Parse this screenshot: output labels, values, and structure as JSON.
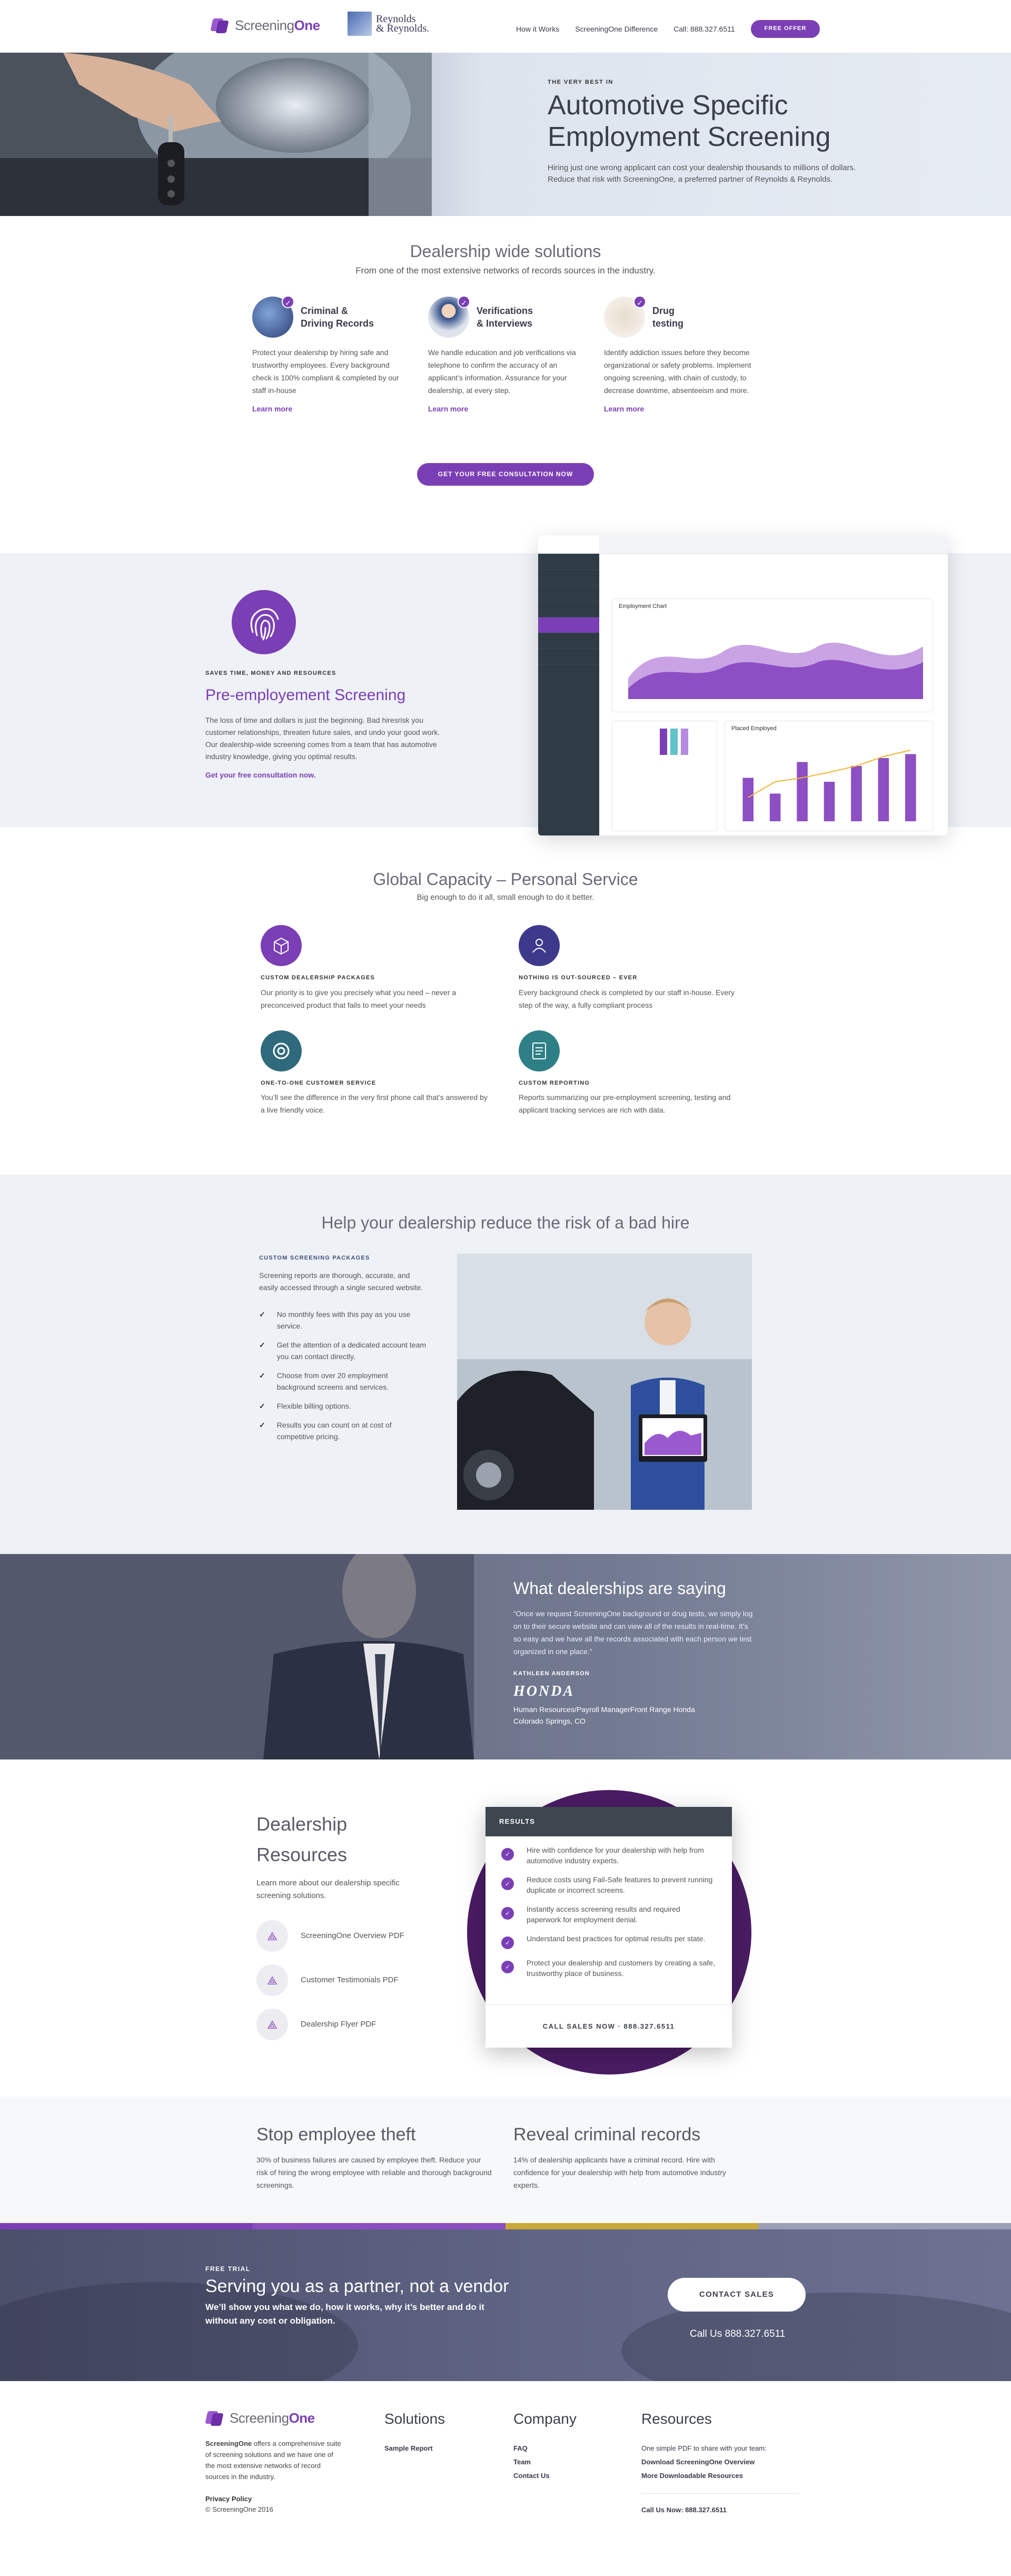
{
  "header": {
    "brand_light": "Screening",
    "brand_bold": "One",
    "partner_logo_line1": "Reynolds",
    "partner_logo_line2": "& Reynolds.",
    "nav": [
      "How it Works",
      "ScreeningOne Difference",
      "Call: 888.327.6511"
    ],
    "cta": "FREE OFFER"
  },
  "hero": {
    "eyebrow": "THE VERY BEST IN",
    "title_line1": "Automotive Specific",
    "title_line2": "Employment Screening",
    "sub_line1": "Hiring just one wrong applicant can cost your dealership thousands to millions of dollars.",
    "sub_line2": "Reduce that risk with ScreeningOne, a preferred partner of Reynolds & Reynolds."
  },
  "solutions": {
    "title": "Dealership wide solutions",
    "subtitle": "From one of the most extensive networks of records sources in the industry.",
    "cards": [
      {
        "title_line1": "Criminal &",
        "title_line2": "Driving Records",
        "body": "Protect your dealership by hiring safe and trustworthy employees. Every background check is 100% compliant & completed by our staff in-house",
        "link": "Learn more"
      },
      {
        "title_line1": "Verifications",
        "title_line2": "& Interviews",
        "body": "We handle education and job verifications via telephone to confirm the accuracy of an applicant’s information. Assurance for your dealership, at every step.",
        "link": "Learn more"
      },
      {
        "title_line1": "Drug",
        "title_line2": "testing",
        "body": "Identify addiction issues before they become organizational or safety problems. Implement ongoing screening, with chain of custody, to decrease downtime, absenteeism and more.",
        "link": "Learn more"
      }
    ],
    "button": "GET YOUR FREE CONSULTATION NOW"
  },
  "pre": {
    "kicker": "SAVES TIME, MONEY AND RESOURCES",
    "title": "Pre-employement Screening",
    "body": "The loss of time and dollars is just the beginning. Bad hiresrisk you customer relationships, threaten future sales, and undo your good work. Our dealership-wide screening comes from a team that has automotive industry knowledge, giving you optimal results.",
    "link": "Get your free consultation now."
  },
  "global": {
    "title": "Global Capacity – Personal Service",
    "subtitle": "Big enough to do it all, small enough to do it better.",
    "features": [
      {
        "kicker": "CUSTOM DEALERSHIP PACKAGES",
        "body": "Our priority is to give you precisely what you need – never a preconceived product that fails to meet your needs",
        "color": "#7b3fb5",
        "icon": "box-icon"
      },
      {
        "kicker": "NOTHING IS OUT-SOURCED – EVER",
        "body": "Every background check is completed by our staff in-house. Every step of the way, a fully compliant process",
        "color": "#3d3a8c",
        "icon": "team-icon"
      },
      {
        "kicker": "ONE-TO-ONE CUSTOMER SERVICE",
        "body": "You’ll see the difference in the very first phone call that’s answered by a live friendly voice.",
        "color": "#2f6a7c",
        "icon": "lifebuoy-icon"
      },
      {
        "kicker": "CUSTOM REPORTING",
        "body": "Reports summarizing our pre-employment screening, testing and applicant tracking services are rich with data.",
        "color": "#2e7f86",
        "icon": "report-icon"
      }
    ]
  },
  "help": {
    "title": "Help your dealership reduce the risk of a bad hire",
    "kicker": "CUSTOM SCREENING PACKAGES",
    "intro": "Screening reports are thorough, accurate, and easily accessed through a single secured website.",
    "items": [
      "No monthly fees with this pay as you use service.",
      "Get the attention of a dedicated account team you can contact directly.",
      "Choose from over 20 employment background screens and services.",
      "Flexible billing options.",
      "Results you can count on at cost of competitive pricing."
    ]
  },
  "testimonial": {
    "title": "What dealerships are saying",
    "quote": "“Once we request ScreeningOne background or drug tests, we simply log on to their secure website and can view all of the results in real-time. It’s so easy and we have all the records associated with each person we test organized in one place.”",
    "name": "KATHLEEN ANDERSON",
    "company_logo": "HONDA",
    "role": "Human Resources/Payroll ManagerFront Range Honda",
    "location": "Colorado Springs, CO"
  },
  "resources": {
    "title": "Dealership Resources",
    "intro": "Learn more about our dealership specific screening solutions.",
    "pdfs": [
      "ScreeningOne Overview PDF",
      "Customer Testimonials PDF",
      "Dealership Flyer PDF"
    ],
    "results_title": "RESULTS",
    "results": [
      "Hire with confidence for your dealership with help from automotive industry experts.",
      "Reduce costs using Fail-Safe features to prevent running duplicate or incorrect screens.",
      "Instantly access screening results and required paperwork for employment denial.",
      "Understand best practices for optimal results per state.",
      "Protect your dealership and customers by creating a safe, trustworthy place of business."
    ],
    "call": "CALL SALES NOW  ·  888.327.6511"
  },
  "stop": {
    "left_title": "Stop employee theft",
    "left_body": "30% of business failures are caused by employee theft. Reduce your risk of hiring the wrong employee with reliable and thorough background screenings.",
    "right_title": "Reveal criminal records",
    "right_body": "14% of dealership applicants have a criminal record. Hire with confidence for your dealership with help from automotive industry experts."
  },
  "cta": {
    "kicker": "FREE TRIAL",
    "title": "Serving you as a partner, not a vendor",
    "sub_line1": "We’ll show you what we do, how it works, why it’s better and do it",
    "sub_line2": "without any cost or obligation.",
    "button": "CONTACT SALES",
    "call": "Call Us 888.327.6511",
    "bar_colors": [
      "#7b3fb5",
      "#8a4fc0",
      "#c9a83a",
      "#9aa0b5"
    ]
  },
  "footer": {
    "about_brand": "ScreeningOne",
    "about": " offers a comprehensive suite of screening solutions and we have one of the most extensive networks of record sources in the industry.",
    "privacy": "Privacy Policy",
    "copyright": "© ScreeningOne 2016",
    "solutions_title": "Solutions",
    "solutions": [
      "Sample Report"
    ],
    "company_title": "Company",
    "company": [
      "FAQ",
      "Team",
      "Contact Us"
    ],
    "resources_title": "Resources",
    "resources_intro": "One simple PDF to share with your team:",
    "resources": [
      "Download ScreeningOne Overview",
      "More Downloadable Resources"
    ],
    "call": "Call Us Now: 888.327.6511"
  },
  "dashboard": {
    "chart1_title": "Employment Chart",
    "chart2_title": "Placed Employed",
    "bar_values": [
      0.55,
      0.35,
      0.75,
      0.5,
      0.7,
      0.8,
      0.85
    ],
    "line_values": [
      0.3,
      0.5,
      0.55,
      0.62,
      0.7,
      0.82,
      0.9
    ]
  },
  "colors": {
    "brand": "#7b3fb5",
    "dark": "#2f3b45"
  }
}
